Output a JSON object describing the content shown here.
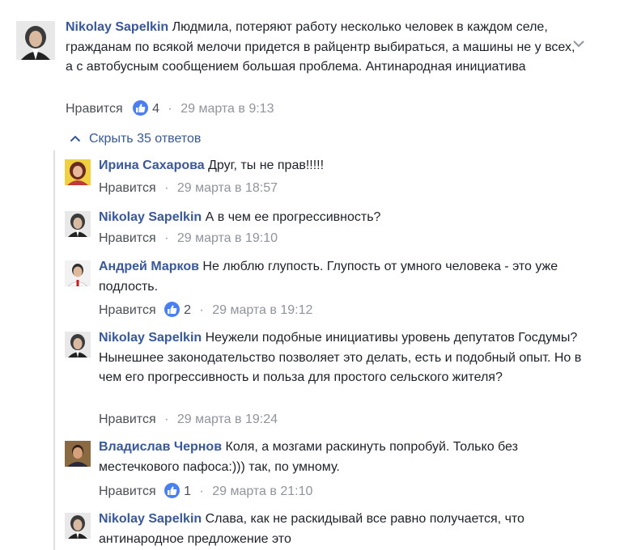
{
  "root": {
    "author": "Nikolay Sapelkin",
    "text": "Людмила, потеряют работу несколько человек в каждом селе, гражданам по всякой мелочи придется в райцентр выбираться, а машины не у всех, а с автобусным сообщением большая проблема. Антинародная инициатива",
    "like_label": "Нравится",
    "like_count": "4",
    "time": "29 марта в 9:13"
  },
  "hide_replies_label": "Скрыть 35 ответов",
  "replies": [
    {
      "author": "Ирина Сахарова",
      "text": "Друг, ты не прав!!!!!",
      "like_label": "Нравится",
      "like_count": "",
      "time": "29 марта в 18:57"
    },
    {
      "author": "Nikolay Sapelkin",
      "text": "А в чем ее прогрессивность?",
      "like_label": "Нравится",
      "like_count": "",
      "time": "29 марта в 19:10"
    },
    {
      "author": "Андрей Марков",
      "text": "Не люблю глупость. Глупость от умного человека - это уже подлость.",
      "like_label": "Нравится",
      "like_count": "2",
      "time": "29 марта в 19:12"
    },
    {
      "author": "Nikolay Sapelkin",
      "text": "Неужели подобные инициативы уровень депутатов Госдумы? Нынешнее законодательство позволяет это делать, есть и подобный опыт. Но в чем его прогрессивность и польза для простого сельского жителя?",
      "like_label": "Нравится",
      "like_count": "",
      "time": "29 марта в 19:24"
    },
    {
      "author": "Владислав Чернов",
      "text": "Коля, а мозгами раскинуть попробуй. Только без местечкового пафоса:))) так, по умному.",
      "like_label": "Нравится",
      "like_count": "1",
      "time": "29 марта в 21:10"
    },
    {
      "author": "Nikolay Sapelkin",
      "text": "Слава, как не раскидывай все равно получается, что антинародное предложение это",
      "like_label": "",
      "like_count": "",
      "time": ""
    }
  ],
  "colors": {
    "link": "#385898",
    "meta": "#90949c",
    "like_badge": "#4a7ff2",
    "thread_line": "#dddfe2"
  },
  "icons": {
    "options": "chevron-down-icon",
    "collapse": "chevron-up-icon",
    "like": "thumbs-up-icon"
  }
}
